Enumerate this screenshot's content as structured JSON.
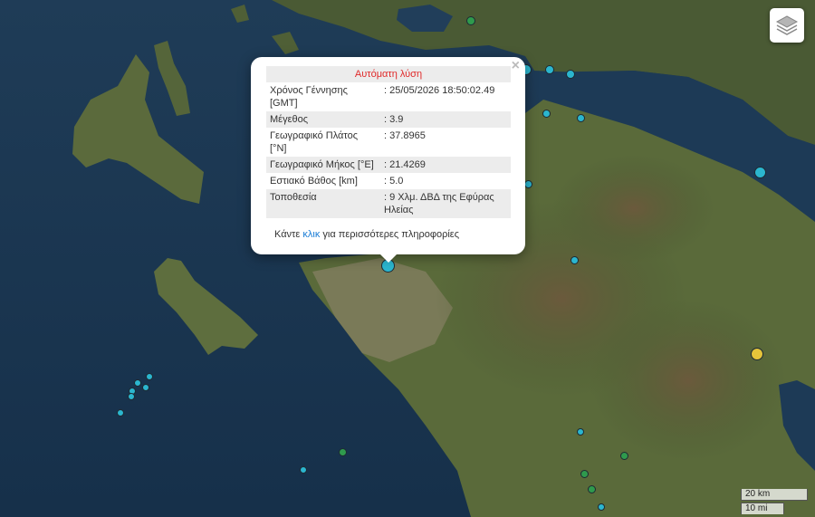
{
  "popup": {
    "title": "Αυτόματη λύση",
    "close_symbol": "×",
    "rows": [
      {
        "label": "Χρόνος Γέννησης [GMT]",
        "value": ": 25/05/2026 18:50:02.49"
      },
      {
        "label": "Μέγεθος",
        "value": ": 3.9"
      },
      {
        "label": "Γεωγραφικό Πλάτος [°N]",
        "value": ": 37.8965"
      },
      {
        "label": "Γεωγραφικό Μήκος [°E]",
        "value": ": 21.4269"
      },
      {
        "label": "Εστιακό Βάθος [km]",
        "value": ": 5.0"
      },
      {
        "label": "Τοποθεσία",
        "value": ": 9 Χλμ. ΔΒΔ της Εφύρας Ηλείας"
      }
    ],
    "more_prefix": "Κάντε",
    "more_link": "κλικ",
    "more_suffix": "για περισσότερες πληροφορίες"
  },
  "scale": {
    "km": "20 km",
    "mi": "10 mi"
  },
  "controls": {
    "layers_icon": "layers-icon"
  },
  "marker_colors": {
    "cyan": "#2bb6cf",
    "green": "#2f9a4d",
    "yellow": "#e5c43a"
  }
}
